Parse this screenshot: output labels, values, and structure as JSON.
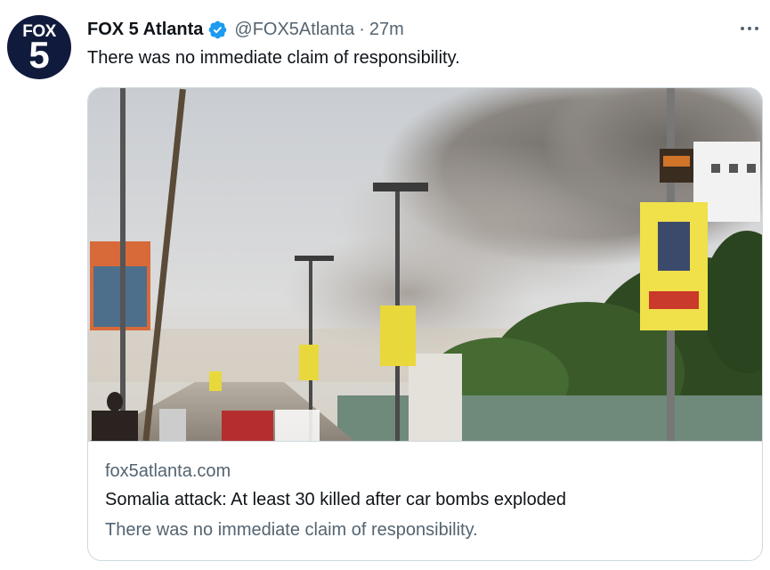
{
  "tweet": {
    "avatar_icon": "fox-5-logo",
    "avatar_logo_top": "FOX",
    "avatar_logo_num": "5",
    "display_name": "FOX 5 Atlanta",
    "verified_icon": "verified-badge-icon",
    "handle": "@FOX5Atlanta",
    "separator": "·",
    "time": "27m",
    "more_icon": "more-horizontal-icon",
    "text": "There was no immediate claim of responsibility."
  },
  "card": {
    "image": "photo-of-smoke-over-street",
    "domain": "fox5atlanta.com",
    "title": "Somalia attack: At least 30 killed after car bombs exploded",
    "description": "There was no immediate claim of responsibility."
  },
  "colors": {
    "text_primary": "#0f1419",
    "text_secondary": "#536471",
    "verified_blue": "#1d9bf0",
    "border": "#cfd9de"
  }
}
